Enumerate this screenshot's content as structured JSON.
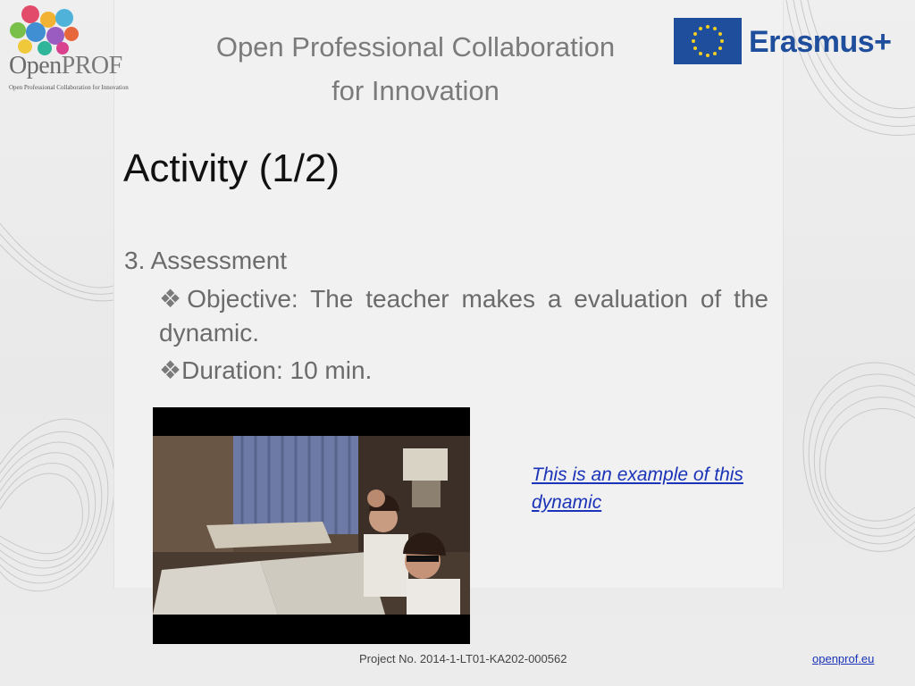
{
  "header": {
    "title_line1": "Open Professional Collaboration",
    "title_line2": "for Innovation"
  },
  "logo_left": {
    "brand_prefix": "Open",
    "brand_suffix": "PROF",
    "tagline": "Open Professional Collaboration for Innovation"
  },
  "eu_logo": {
    "text": "Erasmus+"
  },
  "slide": {
    "title": "Activity (1/2)",
    "section": "3. Assessment",
    "bullets": [
      {
        "mark": "❖",
        "text": "Objective: The teacher makes a evaluation of the dynamic."
      },
      {
        "mark": "❖",
        "text": "Duration: 10 min."
      }
    ],
    "link_text": "This is an example of this dynamic"
  },
  "footer": {
    "project": "Project No. 2014-1-LT01-KA202-000562",
    "site": "openprof.eu"
  },
  "colors": {
    "eu_blue": "#1f4e9c",
    "link_blue": "#1a33b8",
    "text_gray": "#6b6b6b"
  }
}
